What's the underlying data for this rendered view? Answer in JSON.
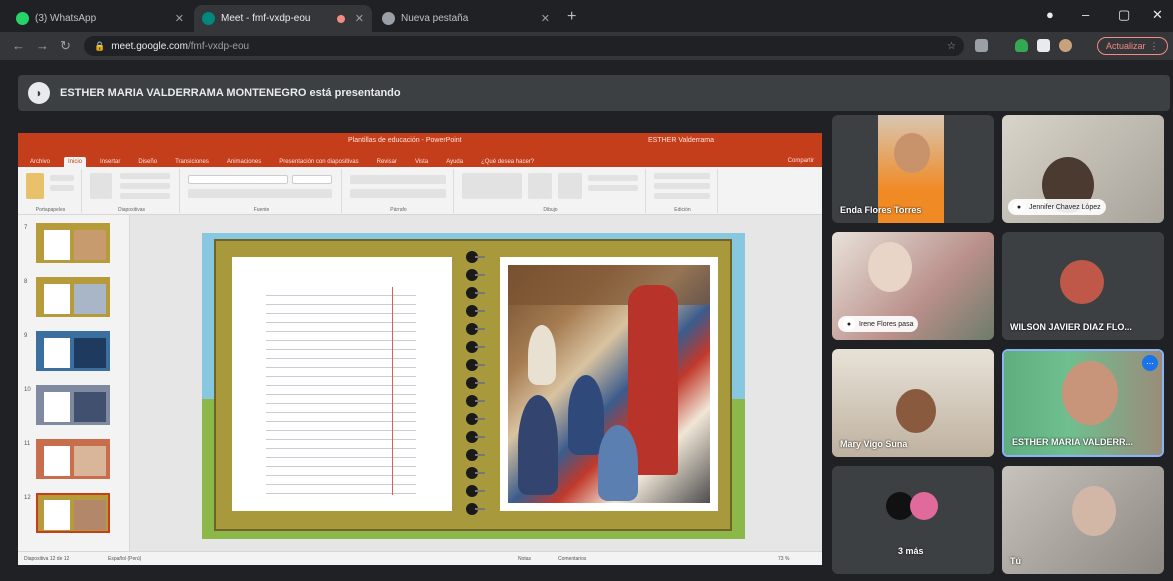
{
  "browser": {
    "tabs": [
      {
        "label": "(3) WhatsApp",
        "favicon_color": "#25d366",
        "active": false
      },
      {
        "label": "Meet - fmf-vxdp-eou",
        "favicon_color": "#00897b",
        "active": true
      },
      {
        "label": "Nueva pestaña",
        "favicon_color": "#9aa0a6",
        "active": false
      }
    ],
    "new_tab_label": "+",
    "url_host": "meet.google.com",
    "url_path": "/fmf-vxdp-eou",
    "update_label": "Actualizar",
    "colors": {
      "recording_dot": "#f28b82"
    }
  },
  "meet": {
    "presenting_text": "ESTHER MARIA VALDERRAMA MONTENEGRO está presentando",
    "participants": [
      {
        "name": "Enda Flores Torres",
        "style": "plain"
      },
      {
        "name": "Jennifer Chavez López",
        "style": "pill"
      },
      {
        "name": "Irene Flores pasa",
        "style": "pill"
      },
      {
        "name": "WILSON JAVIER DIAZ FLO...",
        "style": "plain"
      },
      {
        "name": "Mary Vigo Suna",
        "style": "plain"
      },
      {
        "name": "ESTHER MARIA VALDERR...",
        "style": "plain",
        "active": true
      },
      {
        "name": "3 más",
        "style": "plain"
      },
      {
        "name": "Tú",
        "style": "plain"
      }
    ]
  },
  "powerpoint": {
    "title": "Plantillas de educación - PowerPoint",
    "user": "ESTHER Valderrama",
    "tabs": [
      "Archivo",
      "Inicio",
      "Insertar",
      "Diseño",
      "Transiciones",
      "Animaciones",
      "Presentación con diapositivas",
      "Revisar",
      "Vista",
      "Ayuda",
      "¿Qué desea hacer?"
    ],
    "selected_tab": "Inicio",
    "share_label": "Compartir",
    "ribbon_groups": [
      "Portapapeles",
      "Diapositivas",
      "Fuente",
      "Párrafo",
      "Dibujo",
      "Edición"
    ],
    "slide_numbers": [
      "7",
      "8",
      "9",
      "10",
      "11",
      "12"
    ],
    "status_left": "Diapositiva 12 de 12",
    "status_lang": "Español (Perú)",
    "status_notes": "Notas",
    "status_comments": "Comentarios",
    "status_zoom": "73 %",
    "colors": {
      "brand": "#c43e1c"
    }
  }
}
